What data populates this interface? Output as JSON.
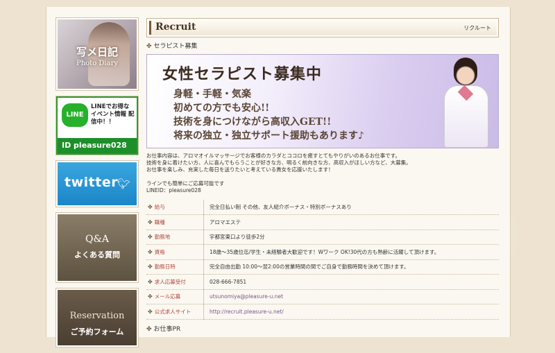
{
  "sidebar": {
    "diary_title": "写メ日記",
    "diary_sub": "Photo Diary",
    "line_label": "LINE",
    "line_text": "LINEでお得な イベント情報 配信中！！",
    "line_id": "ID pleasure028",
    "twitter_label": "twitter",
    "qa_title": "Q&A",
    "qa_sub": "よくある質問",
    "reservation_title": "Reservation",
    "reservation_sub": "ご予約フォーム"
  },
  "header": {
    "title": "Recruit",
    "title_kana": "リクルート"
  },
  "section": {
    "subheading": "セラピスト募集",
    "pr_heading": "お仕事PR"
  },
  "banner": {
    "headline": "女性セラピスト募集中",
    "lines": [
      "身軽・手軽・気楽",
      "初めての方でも安心!!",
      "技術を身につけながら高収入GET!!",
      "将来の独立・独立サポート援助もあります♪"
    ]
  },
  "description": {
    "lines": [
      "お仕事内容は、アロマオイルマッサージでお客様のカラダとココロを癒すとてもやりがいのあるお仕事です。",
      "技術を身に着けたい方、人に喜んでもらうことが好きな方、明るく前向きな方、高収入がほしい方など、大募集。",
      "お仕事を楽しみ、充実した毎日を送りたいと考えている貴女を応援いたします！"
    ],
    "line_note": "ラインでも簡単にご応募可能です",
    "line_id": "LINEID：pleasure028"
  },
  "info_rows": [
    {
      "label": "給与",
      "value": "完全日払い制 その他、友人紹介ボーナス・特別ボーナスあり",
      "link": false
    },
    {
      "label": "職種",
      "value": "アロマエステ",
      "link": false
    },
    {
      "label": "勤務地",
      "value": "宇都宮東口より徒歩2分",
      "link": false
    },
    {
      "label": "資格",
      "value": "18歳〜35歳位迄/学生・未経験者大歓迎です！Wワーク OK!30代の方も熟齢に活躍して頂けます。",
      "link": false
    },
    {
      "label": "勤務日時",
      "value": "完全自由出勤 10:00〜翌2:00の営業時間の間でご自身で勤務時間を決めて頂けます。",
      "link": false
    },
    {
      "label": "求人応募受付",
      "value": "028-666-7851",
      "link": false
    },
    {
      "label": "メール応募",
      "value": "utsunomiya@pleasure-u.net",
      "link": true
    },
    {
      "label": "公式求人サイト",
      "value": "http://recruit.pleasure-u.net/",
      "link": true
    }
  ]
}
